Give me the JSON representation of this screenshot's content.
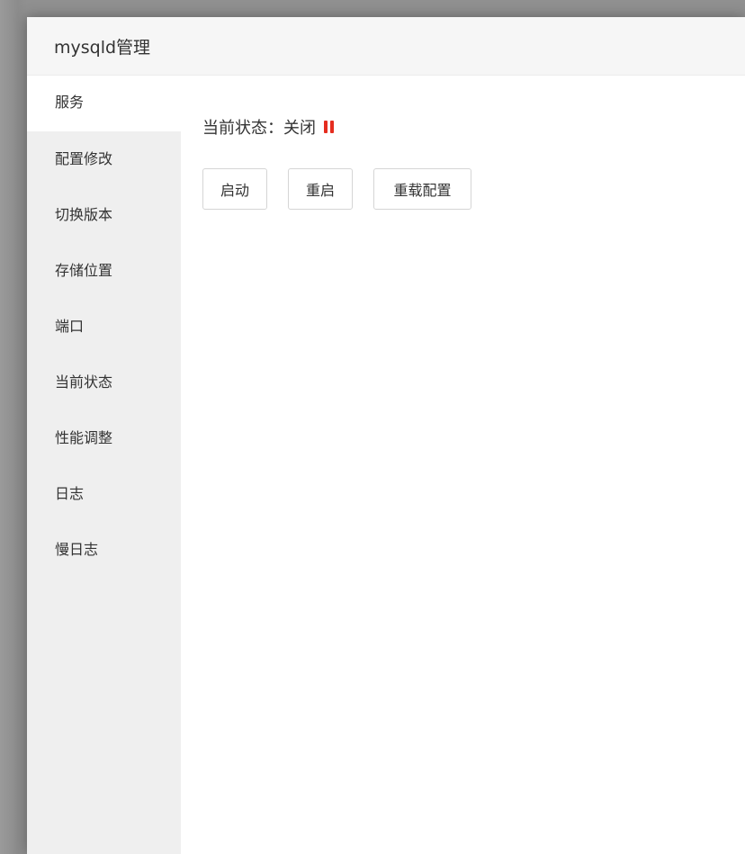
{
  "dialog": {
    "title": "mysqld管理"
  },
  "sidebar": {
    "items": [
      {
        "label": "服务",
        "active": true
      },
      {
        "label": "配置修改"
      },
      {
        "label": "切换版本"
      },
      {
        "label": "存储位置"
      },
      {
        "label": "端口"
      },
      {
        "label": "当前状态"
      },
      {
        "label": "性能调整"
      },
      {
        "label": "日志"
      },
      {
        "label": "慢日志"
      }
    ]
  },
  "service": {
    "status_label": "当前状态：",
    "status_value": "关闭",
    "status_icon": "pause-icon",
    "status_color": "#e52d1f",
    "buttons": {
      "start": "启动",
      "restart": "重启",
      "reload": "重载配置"
    }
  }
}
